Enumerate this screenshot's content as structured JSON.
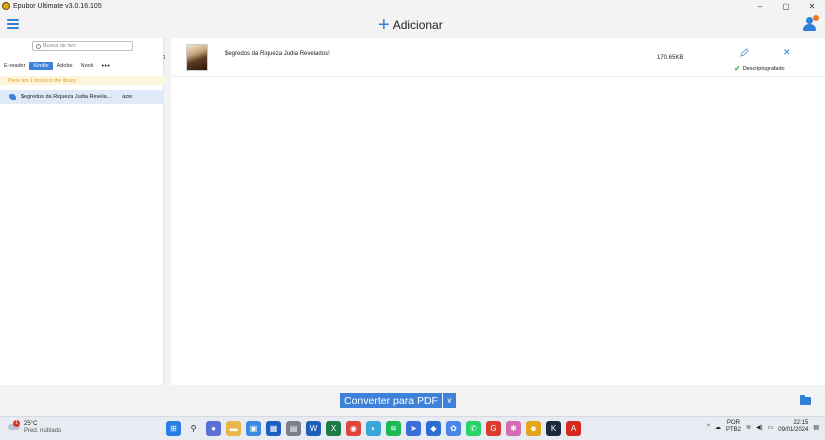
{
  "window": {
    "title": "Epubor Ultimate v3.0.16.105",
    "controls": [
      "–",
      "▢",
      "✕"
    ]
  },
  "header": {
    "add_label": "Adicionar"
  },
  "left": {
    "search_placeholder": "Busca de livo",
    "tabs": [
      "E-reader",
      "Kindle",
      "Adobe",
      "Nook"
    ],
    "active_tab": "Kindle",
    "more": "•••",
    "count_text": "There are 1 books in the library",
    "book": {
      "title": "$egredos da Riqueza Judia Revela...",
      "format": "azw"
    },
    "index": "1"
  },
  "right": {
    "file": {
      "name": "$egredos da Riqueza Judia Revelados!",
      "size": "170.65KB",
      "status": "Descriptografado"
    }
  },
  "bottom": {
    "convert_label": "Converter para PDF",
    "convert_arrow": "∨"
  },
  "taskbar": {
    "weather": {
      "temp": "25°C",
      "desc": "Pred. nublado",
      "badge": "1"
    },
    "language": {
      "top": "POR",
      "bottom": "PTB2"
    },
    "clock": {
      "time": "22:15",
      "date": "09/01/2024"
    }
  },
  "colors": {
    "accent": "#3d82d8",
    "strip_bg": "#fef6dc",
    "strip_text": "#e0a030",
    "success": "#1f9a3a"
  }
}
